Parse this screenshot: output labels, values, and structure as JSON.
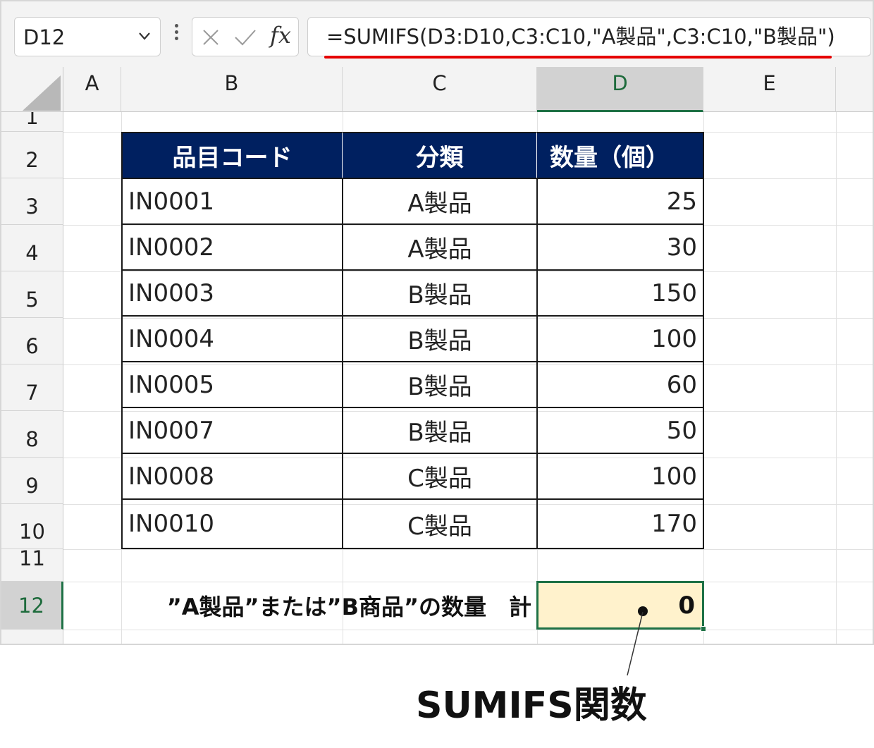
{
  "formula_bar": {
    "name_box": "D12",
    "fx_label": "fx",
    "formula": "=SUMIFS(D3:D10,C3:C10,\"A製品\",C3:C10,\"B製品\")"
  },
  "columns": [
    "A",
    "B",
    "C",
    "D",
    "E"
  ],
  "selected_column": "D",
  "rows": [
    "1",
    "2",
    "3",
    "4",
    "5",
    "6",
    "7",
    "8",
    "9",
    "10",
    "11",
    "12"
  ],
  "selected_row": "12",
  "table": {
    "headers": [
      "品目コード",
      "分類",
      "数量（個）"
    ],
    "rows": [
      {
        "code": "IN0001",
        "category": "A製品",
        "qty": "25"
      },
      {
        "code": "IN0002",
        "category": "A製品",
        "qty": "30"
      },
      {
        "code": "IN0003",
        "category": "B製品",
        "qty": "150"
      },
      {
        "code": "IN0004",
        "category": "B製品",
        "qty": "100"
      },
      {
        "code": "IN0005",
        "category": "B製品",
        "qty": "60"
      },
      {
        "code": "IN0007",
        "category": "B製品",
        "qty": "50"
      },
      {
        "code": "IN0008",
        "category": "C製品",
        "qty": "100"
      },
      {
        "code": "IN0010",
        "category": "C製品",
        "qty": "170"
      }
    ]
  },
  "summary": {
    "label": "”A製品”または”B商品”の数量　計",
    "value": "0"
  },
  "callout": "SUMIFS関数",
  "colors": {
    "header_fill": "#002060",
    "result_fill": "#fff2cc",
    "selection": "#1e7145",
    "underline": "#e60000"
  }
}
